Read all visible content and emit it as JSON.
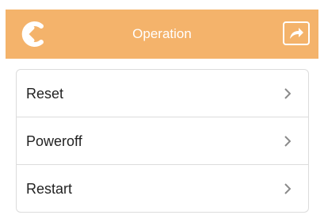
{
  "header": {
    "title": "Operation",
    "back_icon": "back-arrow-icon",
    "share_icon": "share-icon"
  },
  "colors": {
    "header_bg": "#f4b36b",
    "header_text": "#ffffff",
    "row_text": "#222222",
    "divider": "#dcdcdc"
  },
  "menu": {
    "items": [
      {
        "label": "Reset",
        "icon": "chevron-right-icon"
      },
      {
        "label": "Poweroff",
        "icon": "chevron-right-icon"
      },
      {
        "label": "Restart",
        "icon": "chevron-right-icon"
      }
    ]
  }
}
